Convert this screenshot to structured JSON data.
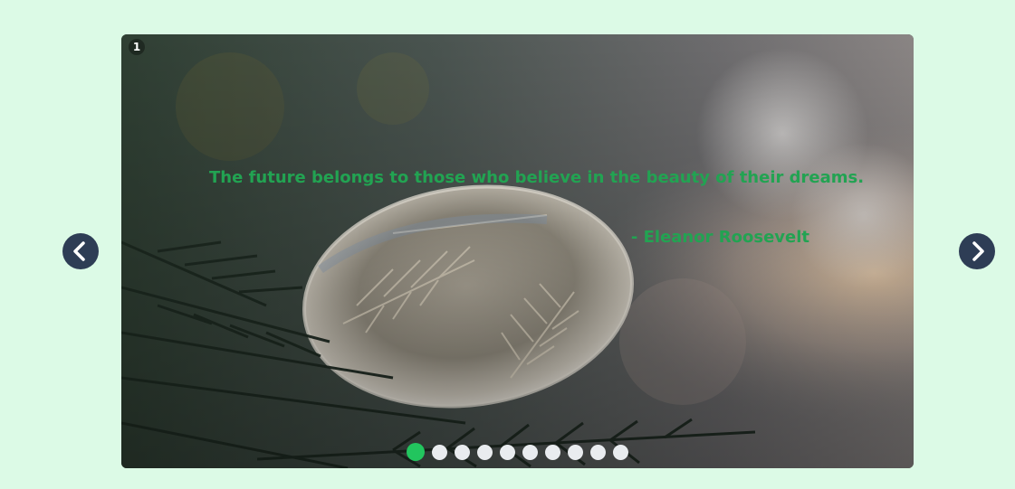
{
  "slider": {
    "slide_number": "1",
    "quote": "The future belongs to those who believe in the beauty of their dreams.",
    "author": "- Eleanor Roosevelt",
    "total_slides": 10,
    "active_slide": 1
  },
  "colors": {
    "page_background": "#dcfae6",
    "accent": "#22c55e",
    "quote_text": "#22a352",
    "nav_button": "#2e3d55",
    "inactive_dot": "#e9ecef"
  },
  "icons": {
    "prev": "chevron-left-icon",
    "next": "chevron-right-icon"
  }
}
